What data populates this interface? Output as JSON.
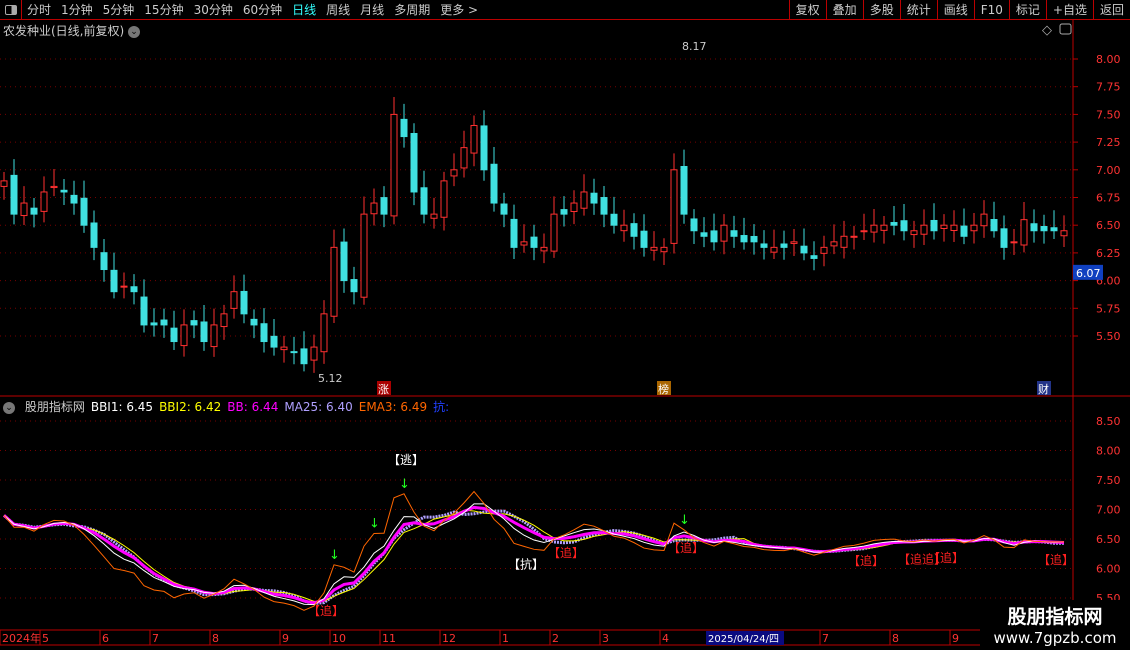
{
  "toolbar": {
    "periods": [
      "分时",
      "1分钟",
      "5分钟",
      "15分钟",
      "30分钟",
      "60分钟",
      "日线",
      "周线",
      "月线",
      "多周期",
      "更多 >"
    ],
    "active": "日线",
    "right": [
      "复权",
      "叠加",
      "多股",
      "统计",
      "画线",
      "F10",
      "标记",
      "+自选",
      "返回"
    ]
  },
  "stock": {
    "title": "农发种业(日线,前复权)",
    "last_price": "6.07",
    "high_label": "8.17",
    "low_label": "5.12",
    "markers": [
      "涨",
      "榜",
      "财"
    ]
  },
  "indicator": {
    "name": "股朋指标网",
    "values": [
      {
        "label": "BBI1: 6.45",
        "color": "#ffffff"
      },
      {
        "label": "BBI2: 6.42",
        "color": "#ffff00"
      },
      {
        "label": "BB: 6.44",
        "color": "#ff00ff"
      },
      {
        "label": "MA25: 6.40",
        "color": "#b0a0ff"
      },
      {
        "label": "EMA3: 6.49",
        "color": "#ff6600"
      },
      {
        "label": "抗:",
        "color": "#2040ff"
      }
    ],
    "annotations": [
      {
        "text": "【追】",
        "i": 32,
        "color": "#ff2020",
        "below": true
      },
      {
        "text": "【逃】",
        "i": 40,
        "color": "#ffffff",
        "below": false
      },
      {
        "text": "【抗】",
        "i": 52,
        "color": "#ffffff",
        "below": true
      },
      {
        "text": "【追】",
        "i": 56,
        "color": "#ff2020",
        "below": true
      },
      {
        "text": "【追】",
        "i": 68,
        "color": "#ff2020",
        "below": true
      },
      {
        "text": "【追】",
        "i": 86,
        "color": "#ff2020",
        "below": true
      },
      {
        "text": "【追追】",
        "i": 91,
        "color": "#ff2020",
        "below": true
      },
      {
        "text": "【追】",
        "i": 94,
        "color": "#ff2020",
        "below": true
      },
      {
        "text": "【追】",
        "i": 105,
        "color": "#ff2020",
        "below": true
      }
    ],
    "arrows": [
      33,
      40,
      37,
      68
    ]
  },
  "xaxis": {
    "labels": [
      {
        "t": "2024年",
        "i": 0
      },
      {
        "t": "5",
        "i": 4
      },
      {
        "t": "6",
        "i": 10
      },
      {
        "t": "7",
        "i": 15
      },
      {
        "t": "8",
        "i": 21
      },
      {
        "t": "9",
        "i": 28
      },
      {
        "t": "10",
        "i": 33
      },
      {
        "t": "11",
        "i": 38
      },
      {
        "t": "12",
        "i": 44
      },
      {
        "t": "1",
        "i": 50
      },
      {
        "t": "2",
        "i": 55
      },
      {
        "t": "3",
        "i": 60
      },
      {
        "t": "4",
        "i": 66
      },
      {
        "t": "7",
        "i": 82
      },
      {
        "t": "8",
        "i": 89
      },
      {
        "t": "9",
        "i": 95
      }
    ],
    "cursor_label": "2025/04/24/四"
  },
  "watermark": {
    "name": "股朋指标网",
    "url": "www.7gpzb.com"
  },
  "chart_data": {
    "type": "candlestick",
    "price_ylim": [
      5.2,
      8.3
    ],
    "price_ticks": [
      5.5,
      5.75,
      6.0,
      6.25,
      6.5,
      6.75,
      7.0,
      7.25,
      7.5,
      7.75,
      8.0
    ],
    "ind_ylim": [
      5.4,
      8.8
    ],
    "ind_ticks": [
      5.5,
      6.0,
      6.5,
      7.0,
      7.5,
      8.0,
      8.5
    ],
    "closes": [
      6.9,
      6.6,
      6.7,
      6.6,
      6.8,
      6.85,
      6.8,
      6.7,
      6.5,
      6.3,
      6.1,
      5.9,
      5.95,
      5.9,
      5.6,
      5.6,
      5.6,
      5.45,
      5.6,
      5.6,
      5.45,
      5.6,
      5.7,
      5.9,
      5.7,
      5.6,
      5.45,
      5.4,
      5.4,
      5.35,
      5.25,
      5.4,
      5.7,
      6.3,
      6.0,
      5.9,
      6.6,
      6.7,
      6.6,
      7.5,
      7.3,
      6.8,
      6.6,
      6.6,
      6.9,
      7.0,
      7.2,
      7.4,
      7.0,
      6.7,
      6.6,
      6.3,
      6.35,
      6.3,
      6.3,
      6.6,
      6.6,
      6.7,
      6.8,
      6.7,
      6.6,
      6.5,
      6.5,
      6.4,
      6.3,
      6.3,
      6.3,
      7.0,
      6.6,
      6.45,
      6.4,
      6.35,
      6.5,
      6.4,
      6.35,
      6.35,
      6.3,
      6.3,
      6.3,
      6.35,
      6.25,
      6.2,
      6.3,
      6.35,
      6.4,
      6.4,
      6.45,
      6.5,
      6.5,
      6.5,
      6.45,
      6.45,
      6.5,
      6.45,
      6.5,
      6.5,
      6.4,
      6.5,
      6.6,
      6.45,
      6.3,
      6.35,
      6.55,
      6.45,
      6.45,
      6.45,
      6.45
    ],
    "up_color": "#ff3030",
    "down_color": "#40e0e0"
  }
}
